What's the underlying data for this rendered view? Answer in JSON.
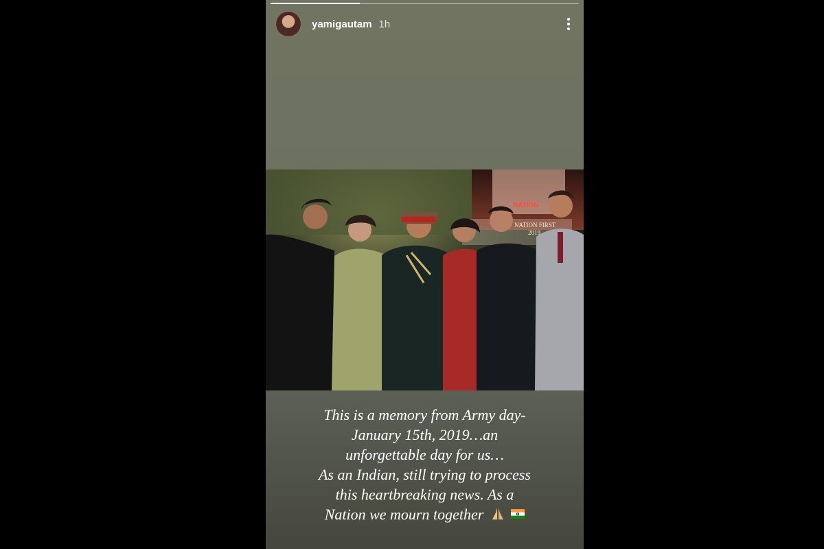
{
  "story": {
    "username": "yamigautam",
    "time_ago": "1h",
    "progress": 0.29,
    "more_icon": "more-vertical-icon",
    "avatar_icon": "profile-avatar"
  },
  "caption": {
    "lines": [
      "This is a memory from Army day-",
      "January 15th, 2019…an",
      "unforgettable day for us…",
      "As an Indian, still trying to process",
      "this heartbreaking news. As a",
      "Nation we mourn together"
    ],
    "emojis": [
      "folded-hands-emoji",
      "india-flag-emoji"
    ]
  },
  "photo": {
    "overlay_text": [
      "NATION",
      "NATION FIRST",
      "2019"
    ]
  },
  "colors": {
    "background": "#000000",
    "story_bg": "#6d7160",
    "text": "#ffffff"
  }
}
